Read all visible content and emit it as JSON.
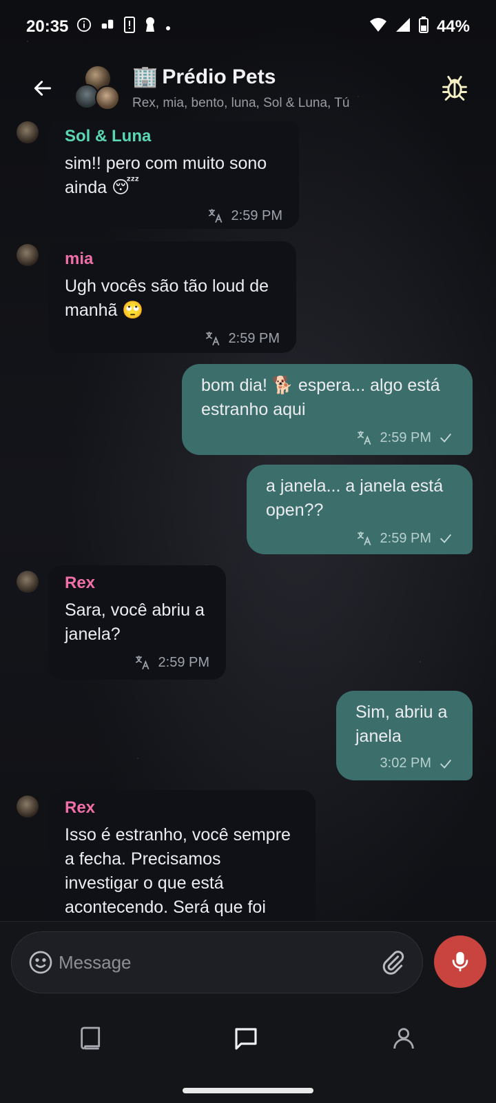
{
  "status_bar": {
    "time": "20:35",
    "battery": "44%"
  },
  "header": {
    "emoji": "🏢",
    "title": "Prédio Pets",
    "members": "Rex, mia, bento, luna, Sol & Luna, Tú"
  },
  "messages": [
    {
      "sender": "Sol & Luna",
      "text": "sim!! pero com muito sono ainda 😴",
      "time": "2:59 PM",
      "color": "#5ad8b5"
    },
    {
      "sender": "mia",
      "text": "Ugh vocês são tão loud de manhã 🙄",
      "time": "2:59 PM",
      "color": "#f06fa8"
    },
    {
      "text": "bom dia! 🐕 espera... algo está estranho aqui",
      "time": "2:59 PM"
    },
    {
      "text": "a janela... a janela está open??",
      "time": "2:59 PM"
    },
    {
      "sender": "Rex",
      "text": "Sara, você abriu a janela?",
      "time": "2:59 PM",
      "color": "#f06fa8"
    },
    {
      "text": "Sim, abriu a janela",
      "time": "3:02 PM"
    },
    {
      "sender": "Rex",
      "text": "Isso é estranho, você sempre a fecha. Precisamos investigar o que está acontecendo. Será que foi",
      "color": "#f06fa8"
    }
  ],
  "composer": {
    "placeholder": "Message"
  },
  "colors": {
    "outgoing": "#3c6e6b",
    "incoming": "#0f1116",
    "mic": "#c9443f"
  },
  "icons": [
    "back-arrow",
    "bug",
    "translate",
    "check",
    "emoji",
    "attach",
    "mic",
    "book",
    "chat",
    "profile"
  ]
}
